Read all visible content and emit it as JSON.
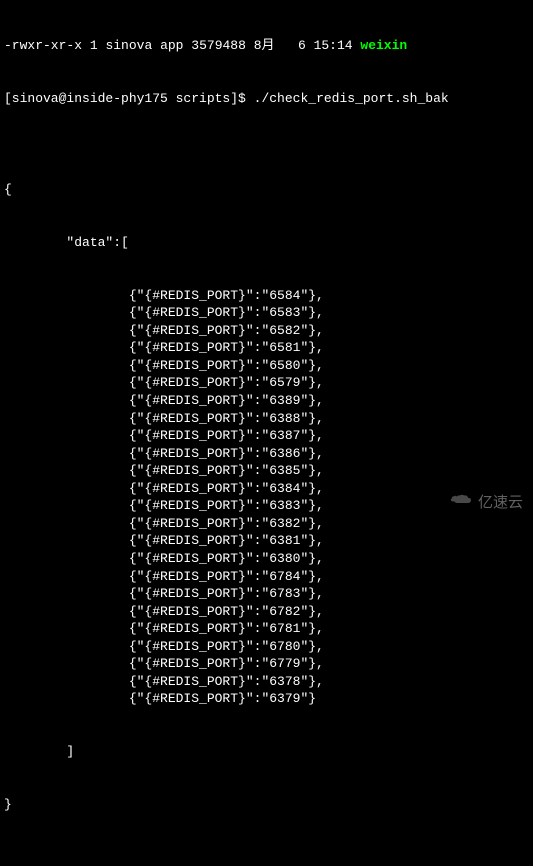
{
  "ls_line": {
    "perms": "-rwxr-xr-x",
    "links": "1",
    "user": "sinova",
    "group": "app",
    "size": "3579488",
    "month": "8月",
    "day": "6",
    "time": "15:14",
    "filename": "weixin"
  },
  "prompt": {
    "user_host": "[sinova@inside-phy175 scripts]$",
    "command": "./check_redis_port.sh_bak"
  },
  "json_open": "{",
  "data_key": "\"data\":[",
  "entries": [
    "{\"{#REDIS_PORT}\":\"6584\"},",
    "{\"{#REDIS_PORT}\":\"6583\"},",
    "{\"{#REDIS_PORT}\":\"6582\"},",
    "{\"{#REDIS_PORT}\":\"6581\"},",
    "{\"{#REDIS_PORT}\":\"6580\"},",
    "{\"{#REDIS_PORT}\":\"6579\"},",
    "{\"{#REDIS_PORT}\":\"6389\"},",
    "{\"{#REDIS_PORT}\":\"6388\"},",
    "{\"{#REDIS_PORT}\":\"6387\"},",
    "{\"{#REDIS_PORT}\":\"6386\"},",
    "{\"{#REDIS_PORT}\":\"6385\"},",
    "{\"{#REDIS_PORT}\":\"6384\"},",
    "{\"{#REDIS_PORT}\":\"6383\"},",
    "{\"{#REDIS_PORT}\":\"6382\"},",
    "{\"{#REDIS_PORT}\":\"6381\"},",
    "{\"{#REDIS_PORT}\":\"6380\"},",
    "{\"{#REDIS_PORT}\":\"6784\"},",
    "{\"{#REDIS_PORT}\":\"6783\"},",
    "{\"{#REDIS_PORT}\":\"6782\"},",
    "{\"{#REDIS_PORT}\":\"6781\"},",
    "{\"{#REDIS_PORT}\":\"6780\"},",
    "{\"{#REDIS_PORT}\":\"6779\"},",
    "{\"{#REDIS_PORT}\":\"6378\"},",
    "{\"{#REDIS_PORT}\":\"6379\"}"
  ],
  "array_close": "]",
  "json_close": "}",
  "watermark_text": "亿速云",
  "indent_key": "        ",
  "indent_entry": "                ",
  "indent_close": "        "
}
